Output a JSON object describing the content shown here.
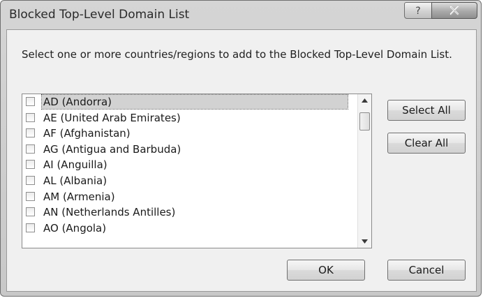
{
  "window": {
    "title": "Blocked Top-Level Domain List",
    "help_glyph": "?",
    "close_glyph": "X"
  },
  "dialog": {
    "instructions": "Select one or more countries/regions to add to the Blocked Top-Level Domain List."
  },
  "list": {
    "items": [
      {
        "label": "AD (Andorra)",
        "checked": false,
        "selected": true
      },
      {
        "label": "AE (United Arab Emirates)",
        "checked": false,
        "selected": false
      },
      {
        "label": "AF (Afghanistan)",
        "checked": false,
        "selected": false
      },
      {
        "label": "AG (Antigua and Barbuda)",
        "checked": false,
        "selected": false
      },
      {
        "label": "AI (Anguilla)",
        "checked": false,
        "selected": false
      },
      {
        "label": "AL (Albania)",
        "checked": false,
        "selected": false
      },
      {
        "label": "AM (Armenia)",
        "checked": false,
        "selected": false
      },
      {
        "label": "AN (Netherlands Antilles)",
        "checked": false,
        "selected": false
      },
      {
        "label": "AO (Angola)",
        "checked": false,
        "selected": false
      }
    ]
  },
  "buttons": {
    "select_all": "Select All",
    "clear_all": "Clear All",
    "ok": "OK",
    "cancel": "Cancel"
  },
  "icons": {
    "help": "help-icon",
    "close": "close-icon",
    "scroll_up": "scroll-up-arrow-icon",
    "scroll_down": "scroll-down-arrow-icon"
  }
}
